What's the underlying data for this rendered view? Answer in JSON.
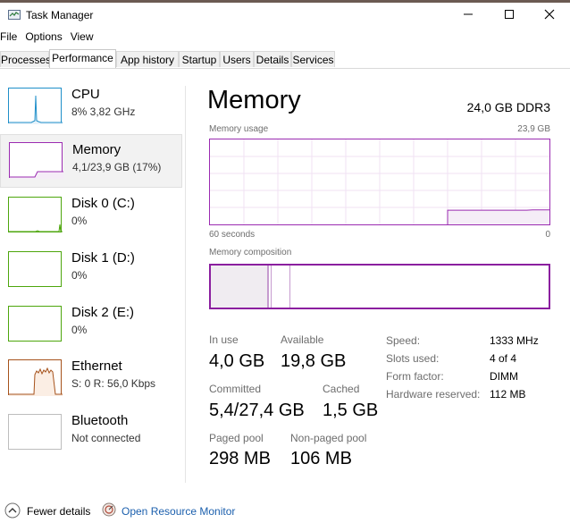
{
  "window": {
    "title": "Task Manager",
    "icon": "task-manager-icon",
    "controls": [
      "minimize-icon",
      "maximize-icon",
      "close-icon"
    ]
  },
  "menu": [
    "File",
    "Options",
    "View"
  ],
  "tabs": [
    {
      "label": "Processes",
      "active": false
    },
    {
      "label": "Performance",
      "active": true
    },
    {
      "label": "App history",
      "active": false
    },
    {
      "label": "Startup",
      "active": false
    },
    {
      "label": "Users",
      "active": false
    },
    {
      "label": "Details",
      "active": false
    },
    {
      "label": "Services",
      "active": false
    }
  ],
  "sidebar": [
    {
      "title": "CPU",
      "subtitle": "8% 3,82 GHz",
      "color": "#1f8fc9",
      "fill": "#e8f3fa"
    },
    {
      "title": "Memory",
      "subtitle": "4,1/23,9 GB (17%)",
      "color": "#9b2bb1",
      "fill": "#f5edf7"
    },
    {
      "title": "Disk 0 (C:)",
      "subtitle": "0%",
      "color": "#4da60c",
      "fill": "#eef7e6"
    },
    {
      "title": "Disk 1 (D:)",
      "subtitle": "0%",
      "color": "#4da60c",
      "fill": "#eef7e6"
    },
    {
      "title": "Disk 2 (E:)",
      "subtitle": "0%",
      "color": "#4da60c",
      "fill": "#eef7e6"
    },
    {
      "title": "Ethernet",
      "subtitle": "S: 0 R: 56,0 Kbps",
      "color": "#a6521b",
      "fill": "#fbeee4"
    },
    {
      "title": "Bluetooth",
      "subtitle": "Not connected",
      "color": "#bdbdbd",
      "fill": "#f3f3f3"
    }
  ],
  "main": {
    "title": "Memory",
    "size": "24,0 GB DDR3",
    "usage_label": "Memory usage",
    "usage_max": "23,9 GB",
    "time_left": "60 seconds",
    "time_right": "0",
    "composition_label": "Memory composition",
    "usage_history_gb": [
      0,
      0,
      0,
      0,
      0,
      0,
      0,
      0,
      0,
      0,
      0,
      0,
      0,
      0,
      0,
      0,
      0,
      0,
      0,
      0,
      0,
      0,
      0,
      0,
      0,
      0,
      0,
      0,
      0,
      0,
      0,
      0,
      0,
      0,
      0,
      0,
      0,
      0,
      0,
      0,
      0,
      0,
      4.0,
      4.0,
      4.0,
      4.0,
      4.0,
      4.0,
      4.0,
      4.0,
      4.0,
      4.0,
      4.0,
      4.0,
      4.0,
      4.0,
      4.0,
      4.1,
      4.1,
      4.1,
      4.1
    ],
    "stats": {
      "in_use_label": "In use",
      "in_use": "4,0 GB",
      "available_label": "Available",
      "available": "19,8 GB",
      "committed_label": "Committed",
      "committed": "5,4/27,4 GB",
      "cached_label": "Cached",
      "cached": "1,5 GB",
      "paged_label": "Paged pool",
      "paged": "298 MB",
      "nonpaged_label": "Non-paged pool",
      "nonpaged": "106 MB"
    },
    "specs": [
      {
        "label": "Speed:",
        "value": "1333 MHz"
      },
      {
        "label": "Slots used:",
        "value": "4 of 4"
      },
      {
        "label": "Form factor:",
        "value": "DIMM"
      },
      {
        "label": "Hardware reserved:",
        "value": "112 MB"
      }
    ]
  },
  "footer": {
    "fewer_label": "Fewer details",
    "link_label": "Open Resource Monitor"
  }
}
